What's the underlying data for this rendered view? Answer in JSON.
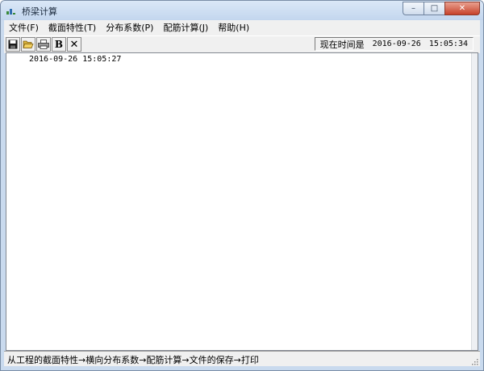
{
  "window": {
    "title": "桥梁计算",
    "controls": {
      "minimize": "–",
      "maximize": "□",
      "close": "✕"
    }
  },
  "menu": {
    "items": [
      {
        "label": "文件(F)"
      },
      {
        "label": "截面特性(T)"
      },
      {
        "label": "分布系数(P)"
      },
      {
        "label": "配筋计算(J)"
      },
      {
        "label": "帮助(H)"
      }
    ]
  },
  "toolbar": {
    "buttons": [
      {
        "icon": "save-icon"
      },
      {
        "icon": "open-folder-icon"
      },
      {
        "icon": "print-icon"
      },
      {
        "icon": "bold-icon",
        "glyph": "B"
      },
      {
        "icon": "close-x-icon",
        "glyph": "✕"
      }
    ],
    "clock_label": "现在时间是",
    "clock_date": "2016-09-26",
    "clock_time": "15:05:34"
  },
  "content": {
    "lines": [
      "2016-09-26   15:05:27"
    ]
  },
  "status": {
    "text": "从工程的截面特性→横向分布系数→配筋计算→文件的保存→打印"
  },
  "colors": {
    "titlebar": "#c9daee",
    "close_button": "#c7422b",
    "chrome": "#f0f0f0"
  }
}
